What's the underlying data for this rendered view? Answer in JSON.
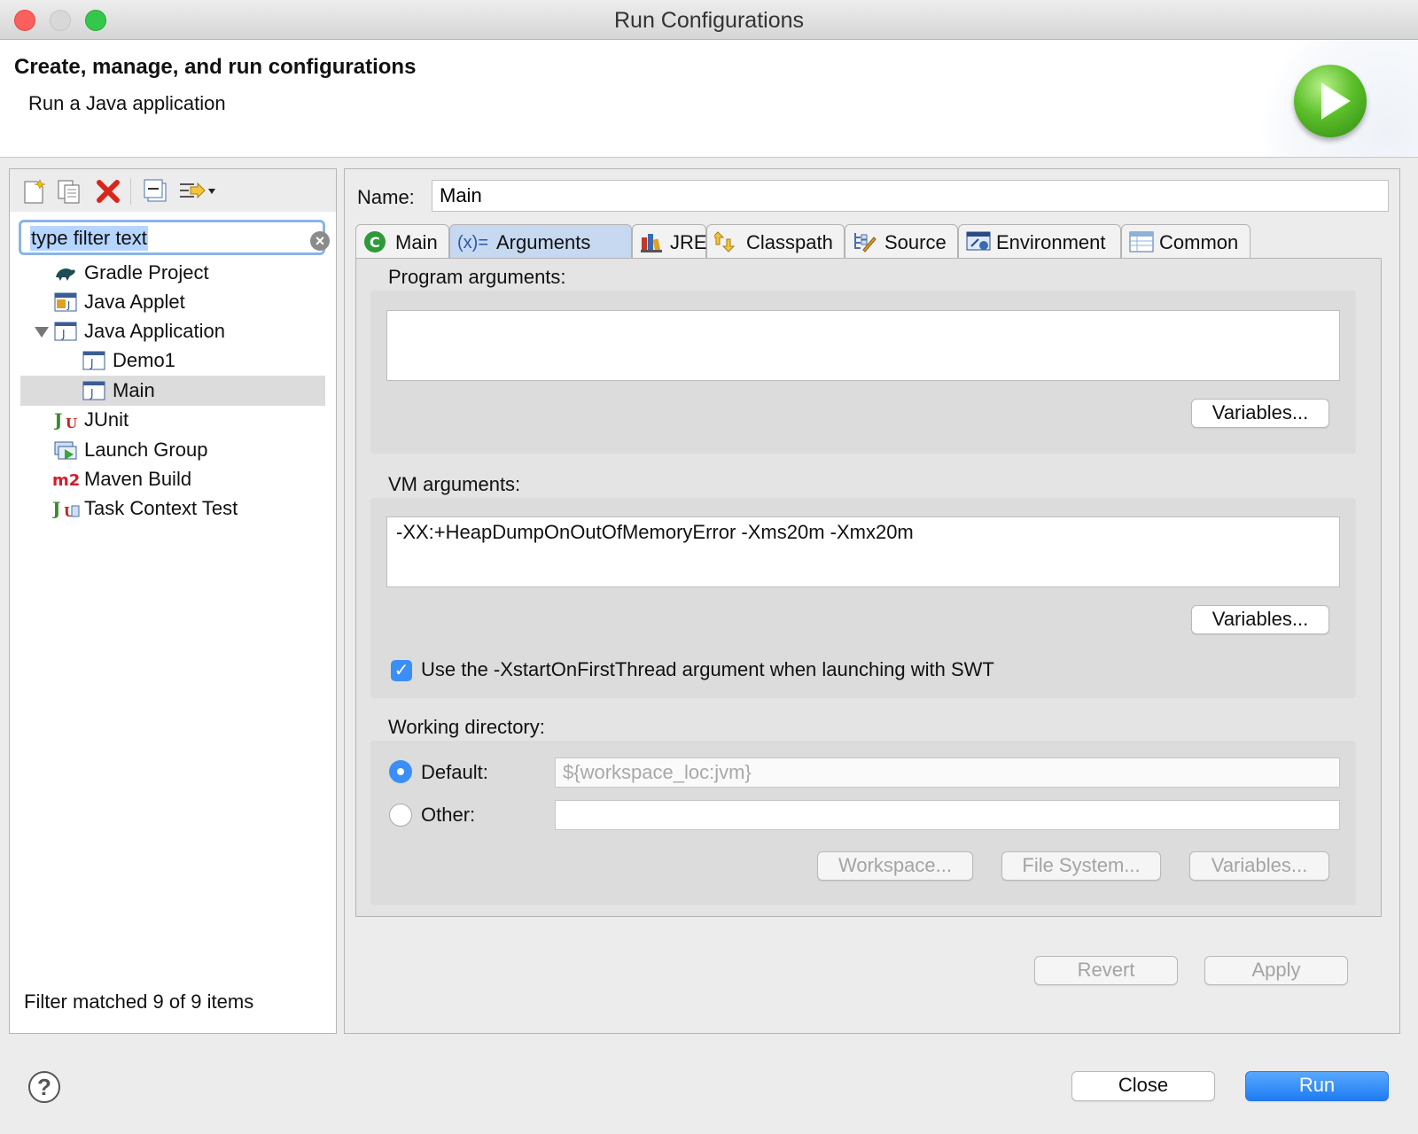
{
  "window": {
    "title": "Run Configurations"
  },
  "header": {
    "title": "Create, manage, and run configurations",
    "subtitle": "Run a Java application",
    "icon": "run-large-icon"
  },
  "left": {
    "toolbar": [
      "new-config-icon",
      "duplicate-icon",
      "delete-icon",
      "collapse-all-icon",
      "filter-menu-icon"
    ],
    "filter": {
      "value": "type filter text"
    },
    "tree": [
      {
        "label": "Gradle Project",
        "icon": "gradle-icon"
      },
      {
        "label": "Java Applet",
        "icon": "java-applet-icon"
      },
      {
        "label": "Java Application",
        "icon": "java-app-icon",
        "expanded": true
      },
      {
        "label": "Demo1",
        "icon": "java-app-icon"
      },
      {
        "label": "Main",
        "icon": "java-app-icon",
        "selected": true
      },
      {
        "label": "JUnit",
        "icon": "junit-icon"
      },
      {
        "label": "Launch Group",
        "icon": "launch-group-icon"
      },
      {
        "label": "Maven Build",
        "icon": "maven-icon"
      },
      {
        "label": "Task Context Test",
        "icon": "task-context-icon"
      }
    ],
    "status": "Filter matched 9 of 9 items"
  },
  "right": {
    "name_label": "Name:",
    "name_value": "Main",
    "tabs": [
      {
        "label": "Main",
        "icon": "class-icon"
      },
      {
        "label": "Arguments",
        "icon": "arguments-icon",
        "icon_text": "(x)=",
        "active": true
      },
      {
        "label": "JRE",
        "icon": "jre-icon"
      },
      {
        "label": "Classpath",
        "icon": "classpath-icon"
      },
      {
        "label": "Source",
        "icon": "source-icon"
      },
      {
        "label": "Environment",
        "icon": "environment-icon"
      },
      {
        "label": "Common",
        "icon": "common-icon"
      }
    ],
    "program_args": {
      "label": "Program arguments:",
      "value": "",
      "variables_label": "Variables..."
    },
    "vm_args": {
      "label": "VM arguments:",
      "value": "-XX:+HeapDumpOnOutOfMemoryError -Xms20m -Xmx20m",
      "variables_label": "Variables..."
    },
    "swt_checkbox": {
      "label": "Use the -XstartOnFirstThread argument when launching with SWT",
      "checked": true
    },
    "working_dir": {
      "label": "Working directory:",
      "default_label": "Default:",
      "default_value": "${workspace_loc:jvm}",
      "other_label": "Other:",
      "other_value": "",
      "workspace_label": "Workspace...",
      "filesystem_label": "File System...",
      "variables_label": "Variables..."
    },
    "revert_label": "Revert",
    "apply_label": "Apply"
  },
  "footer": {
    "help_label": "?",
    "close_label": "Close",
    "run_label": "Run"
  },
  "colors": {
    "accent": "#3b8ef5",
    "run_button": "#1e7cf2",
    "active_tab": "#c7d9f0"
  }
}
